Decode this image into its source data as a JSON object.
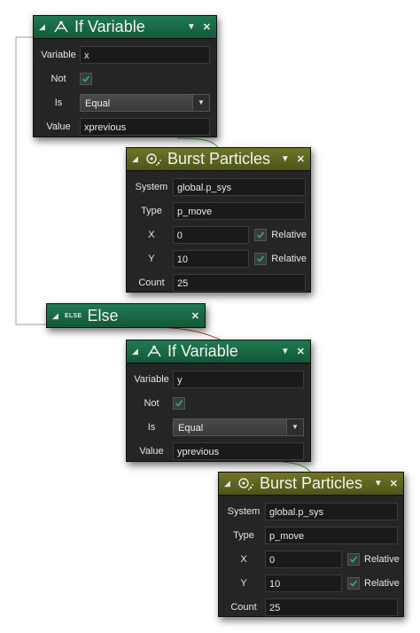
{
  "if_variable_1": {
    "title": "If Variable",
    "fields": {
      "variable_label": "Variable",
      "variable_value": "x",
      "not_label": "Not",
      "is_label": "Is",
      "is_value": "Equal",
      "value_label": "Value",
      "value_value": "xprevious"
    }
  },
  "burst_particles_1": {
    "title": "Burst Particles",
    "fields": {
      "system_label": "System",
      "system_value": "global.p_sys",
      "type_label": "Type",
      "type_value": "p_move",
      "x_label": "X",
      "x_value": "0",
      "x_relative": "Relative",
      "y_label": "Y",
      "y_value": "10",
      "y_relative": "Relative",
      "count_label": "Count",
      "count_value": "25"
    }
  },
  "else_block": {
    "icon_text": "ELSE",
    "title": "Else"
  },
  "if_variable_2": {
    "title": "If Variable",
    "fields": {
      "variable_label": "Variable",
      "variable_value": "y",
      "not_label": "Not",
      "is_label": "Is",
      "is_value": "Equal",
      "value_label": "Value",
      "value_value": "yprevious"
    }
  },
  "burst_particles_2": {
    "title": "Burst Particles",
    "fields": {
      "system_label": "System",
      "system_value": "global.p_sys",
      "type_label": "Type",
      "type_value": "p_move",
      "x_label": "X",
      "x_value": "0",
      "x_relative": "Relative",
      "y_label": "Y",
      "y_value": "10",
      "y_relative": "Relative",
      "count_label": "Count",
      "count_value": "25"
    }
  },
  "colors": {
    "if_header": "#1a6b47",
    "action_header": "#5e6420",
    "panel_bg": "#252525",
    "connector_green": "#4caf50",
    "connector_red": "#c0392b"
  }
}
